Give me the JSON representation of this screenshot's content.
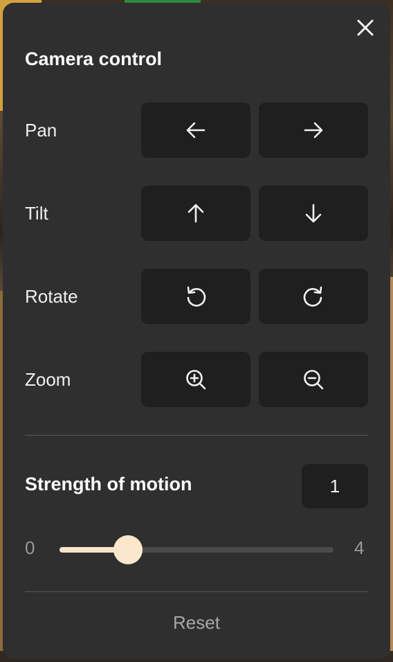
{
  "panel": {
    "title": "Camera control",
    "close_icon": "close-icon"
  },
  "controls": [
    {
      "label": "Pan",
      "left_icon": "arrow-left-icon",
      "right_icon": "arrow-right-icon"
    },
    {
      "label": "Tilt",
      "left_icon": "arrow-up-icon",
      "right_icon": "arrow-down-icon"
    },
    {
      "label": "Rotate",
      "left_icon": "rotate-counterclockwise-icon",
      "right_icon": "rotate-clockwise-icon"
    },
    {
      "label": "Zoom",
      "left_icon": "zoom-in-icon",
      "right_icon": "zoom-out-icon"
    }
  ],
  "strength": {
    "label": "Strength of motion",
    "value": "1",
    "min": "0",
    "max": "4",
    "fraction": 0.25
  },
  "reset_label": "Reset",
  "colors": {
    "panel_bg": "#2f2f2f",
    "button_bg": "#1f1f1f",
    "accent": "#fbe8cc"
  }
}
